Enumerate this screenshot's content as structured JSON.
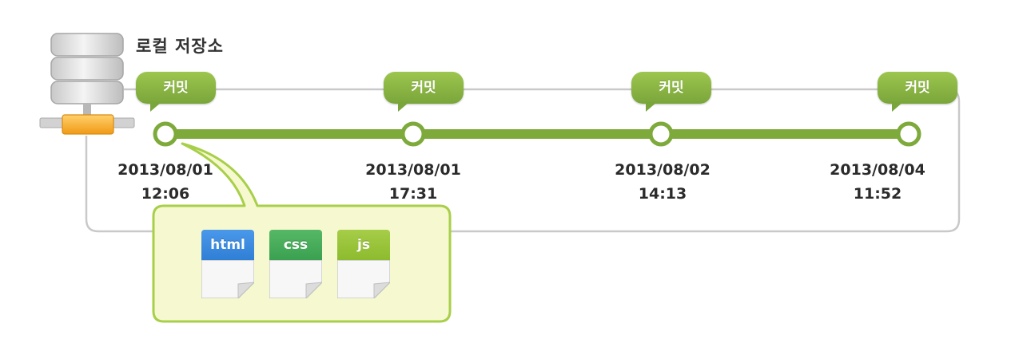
{
  "repository": {
    "label": "로컬 저장소",
    "icon": "database-icon"
  },
  "commits": [
    {
      "badge": "커밋",
      "date": "2013/08/01",
      "time": "12:06"
    },
    {
      "badge": "커밋",
      "date": "2013/08/01",
      "time": "17:31"
    },
    {
      "badge": "커밋",
      "date": "2013/08/02",
      "time": "14:13"
    },
    {
      "badge": "커밋",
      "date": "2013/08/04",
      "time": "11:52"
    }
  ],
  "snapshot_files": [
    {
      "label": "html",
      "color": "#2f7fd6",
      "icon": "html-file-icon"
    },
    {
      "label": "css",
      "color": "#3aa150",
      "icon": "css-file-icon"
    },
    {
      "label": "js",
      "color": "#8dbb2e",
      "icon": "js-file-icon"
    }
  ],
  "colors": {
    "accent_green": "#7aa53a",
    "timeline_green": "#7eaa3c",
    "callout_fill": "#f6f9cf",
    "callout_border": "#a8cf4a",
    "frame_gray": "#c9c9c9",
    "connector_orange": "#f4a623"
  }
}
